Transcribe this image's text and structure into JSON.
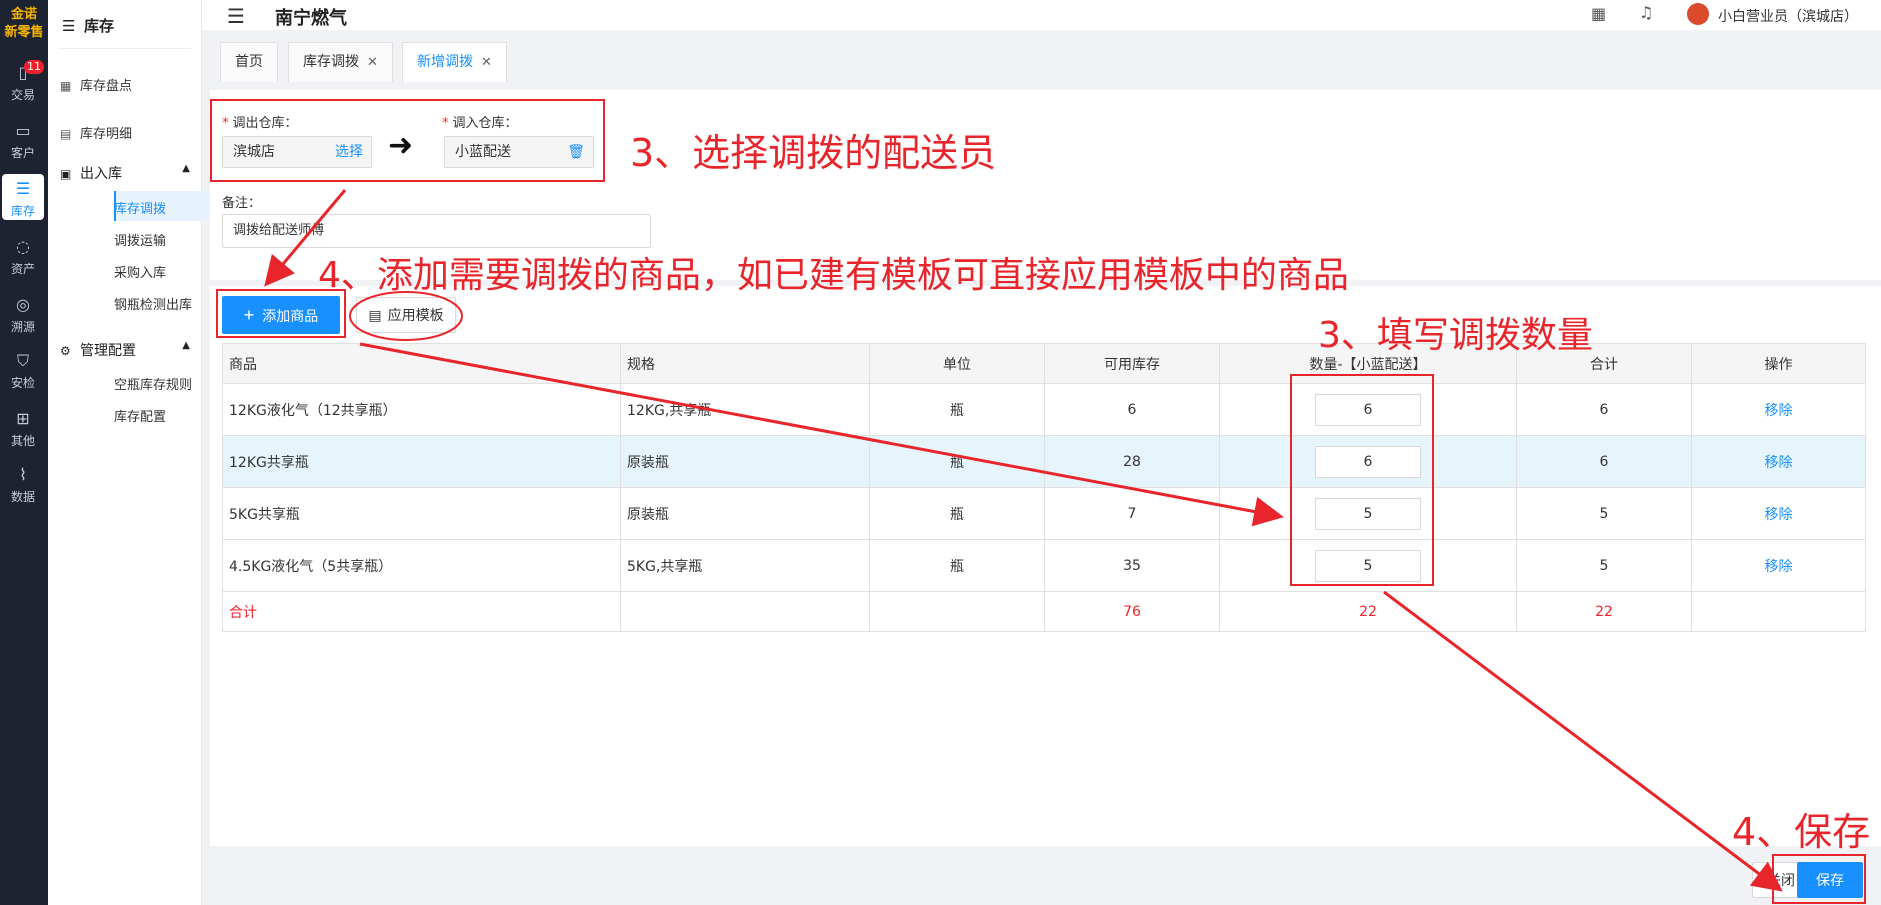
{
  "rail": {
    "logo_line1": "金诺",
    "logo_line2": "新零售",
    "items": [
      {
        "label": "交易",
        "icon": "trade-icon",
        "badge": "11"
      },
      {
        "label": "客户",
        "icon": "customer-icon"
      },
      {
        "label": "库存",
        "icon": "inventory-icon",
        "active": true
      },
      {
        "label": "资产",
        "icon": "asset-icon"
      },
      {
        "label": "溯源",
        "icon": "trace-icon"
      },
      {
        "label": "安检",
        "icon": "safety-icon"
      },
      {
        "label": "其他",
        "icon": "other-icon"
      },
      {
        "label": "数据",
        "icon": "data-icon"
      }
    ]
  },
  "menu": {
    "title": "库存",
    "items": {
      "stocktake": "库存盘点",
      "detail": "库存明细",
      "inout_group": "出入库",
      "transfer": "库存调拨",
      "transport": "调拨运输",
      "purchase": "采购入库",
      "cylinder_out": "钢瓶检测出库",
      "config_group": "管理配置",
      "empty_rule": "空瓶库存规则",
      "stock_config": "库存配置"
    }
  },
  "header": {
    "company": "南宁燃气",
    "user": "小白营业员（滨城店）"
  },
  "tabs": [
    {
      "label": "首页"
    },
    {
      "label": "库存调拨",
      "closable": true
    },
    {
      "label": "新增调拨",
      "closable": true,
      "active": true
    }
  ],
  "form": {
    "out_label": "调出仓库：",
    "out_value": "滨城店",
    "out_action": "选择",
    "in_label": "调入仓库：",
    "in_value": "小蓝配送",
    "remark_label": "备注：",
    "remark_value": "调拨给配送师傅"
  },
  "toolbar": {
    "add_label": "添加商品",
    "template_label": "应用模板"
  },
  "table": {
    "headers": [
      "商品",
      "规格",
      "单位",
      "可用库存",
      "数量-【小蓝配送】",
      "合计",
      "操作"
    ],
    "rows": [
      {
        "name": "12KG液化气（12共享瓶）",
        "spec": "12KG,共享瓶",
        "unit": "瓶",
        "stock": "6",
        "qty": "6",
        "total": "6",
        "op": "移除"
      },
      {
        "name": "12KG共享瓶",
        "spec": "原装瓶",
        "unit": "瓶",
        "stock": "28",
        "qty": "6",
        "total": "6",
        "op": "移除"
      },
      {
        "name": "5KG共享瓶",
        "spec": "原装瓶",
        "unit": "瓶",
        "stock": "7",
        "qty": "5",
        "total": "5",
        "op": "移除"
      },
      {
        "name": "4.5KG液化气（5共享瓶）",
        "spec": "5KG,共享瓶",
        "unit": "瓶",
        "stock": "35",
        "qty": "5",
        "total": "5",
        "op": "移除"
      }
    ],
    "total_row": {
      "label": "合计",
      "stock": "76",
      "qty": "22",
      "total": "22"
    }
  },
  "footer": {
    "close_label": "关闭",
    "save_label": "保存"
  },
  "annotations": {
    "a1": "3、选择调拨的配送员",
    "a2": "4、添加需要调拨的商品，如已建有模板可直接应用模板中的商品",
    "a3": "3、填写调拨数量",
    "a4": "4、保存",
    "color": "#e8252b"
  }
}
